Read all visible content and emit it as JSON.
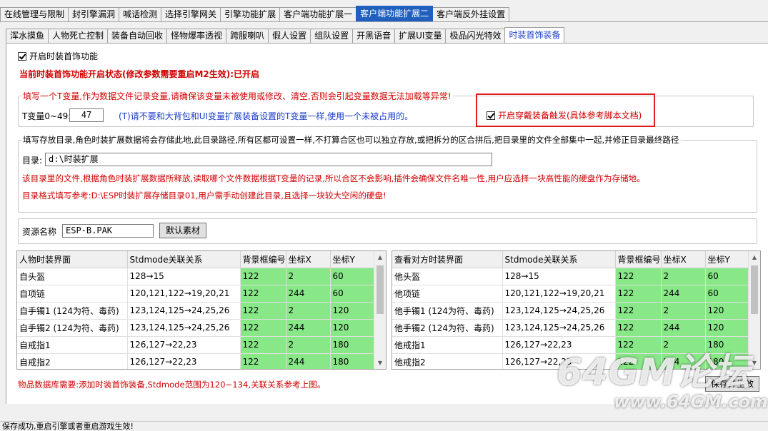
{
  "tabs_row1": [
    "在线管理与限制",
    "封引擎漏洞",
    "喊话检测",
    "选择引擎网关",
    "引擎功能扩展",
    "客户端功能扩展一",
    "客户端功能扩展二",
    "客户端反外挂设置"
  ],
  "tabs_row2": [
    "浑水摸鱼",
    "人物死亡控制",
    "装备自动回收",
    "怪物爆率透视",
    "跨服喇叭",
    "假人设置",
    "组队设置",
    "开黑语音",
    "扩展UI变量",
    "极品闪光特效",
    "时装首饰装备"
  ],
  "feature": {
    "enable_label": "开启时装首饰功能",
    "status_text": "当前时装首饰功能开启状态(修改参数需要重启M2生效):已开启"
  },
  "tvar_group": {
    "title": "填写一个T变量,作为数据文件记录变量,请确保该变量未被使用或修改、清空,否则会引起变量数据无法加载等异常!",
    "label": "T变量0~49:",
    "value": "47",
    "hint": "(T)请不要和大背包和UI变量扩展装备设置的T变量一样,使用一个未被占用的。",
    "trigger_label": "开启穿戴装备触发(具体参考脚本文档)"
  },
  "dir_group": {
    "title": "填写存放目录,角色时装扩展数据将会存储此地,此目录路径,所有区都可设置一样,不打算合区也可以独立存放,或把拆分的区合拼后,把目录里的文件全部集中一起,并修正目录最终路径",
    "label": "目录:",
    "value": "d:\\时装扩展",
    "note1": "该目录里的文件,根据角色时装扩展数据所释放,读取哪个文件数据根据T变量的记录,所以合区不会影响,插件会确保文件名唯一性,用户应选择一块高性能的硬盘作为存储地。",
    "note2": "目录格式填写参考:D:\\ESP时装扩展存储目录01,用户需手动创建此目录,且选择一块较大空闲的硬盘!"
  },
  "resource": {
    "label": "资源名称",
    "value": "ESP-B.PAK",
    "default_button": "默认素材"
  },
  "left_table": {
    "headers": [
      "人物时装界面",
      "Stdmode关联关系",
      "背景框编号",
      "坐标X",
      "坐标Y"
    ],
    "rows": [
      [
        "自头盔",
        "128→15",
        "122",
        "2",
        "60"
      ],
      [
        "自项链",
        "120,121,122→19,20,21",
        "122",
        "244",
        "60"
      ],
      [
        "自手镯1 (124为符、毒药)",
        "123,124,125→24,25,26",
        "122",
        "2",
        "120"
      ],
      [
        "自手镯2 (124为符、毒药)",
        "123,124,125→24,25,26",
        "122",
        "244",
        "120"
      ],
      [
        "自戒指1",
        "126,127→22,23",
        "122",
        "2",
        "180"
      ],
      [
        "自戒指2",
        "126,127→22,23",
        "122",
        "244",
        "180"
      ]
    ]
  },
  "right_table": {
    "headers": [
      "查看对方时装界面",
      "Stdmode关联关系",
      "背景框编号",
      "坐标X",
      "坐标Y"
    ],
    "rows": [
      [
        "他头盔",
        "128→15",
        "122",
        "2",
        "60"
      ],
      [
        "他项链",
        "120,121,122→19,20,21",
        "122",
        "244",
        "60"
      ],
      [
        "他手镯1 (124为符、毒药)",
        "123,124,125→24,25,26",
        "122",
        "2",
        "120"
      ],
      [
        "他手镯2 (124为符、毒药)",
        "123,124,125→24,25,26",
        "122",
        "244",
        "120"
      ],
      [
        "他戒指1",
        "126,127→22,23",
        "122",
        "2",
        "180"
      ],
      [
        "他戒指2",
        "126,127→22,23",
        "122",
        "244",
        "180"
      ]
    ]
  },
  "footer_note": "物品数据库需要:添加时装首饰装备,Stdmode范围为120~134,关联关系参考上图。",
  "save_button": "保存并生效",
  "status_bar": "保存成功,重启引擎或者重启游戏生效!",
  "watermark": {
    "big": "64GM论坛",
    "small": "www.64GM.com"
  },
  "colors": {
    "highlight_green": "#88e888",
    "alert_red": "#d00000",
    "hint_blue": "#1a3cc8",
    "active_tab": "#1f5fbf"
  }
}
